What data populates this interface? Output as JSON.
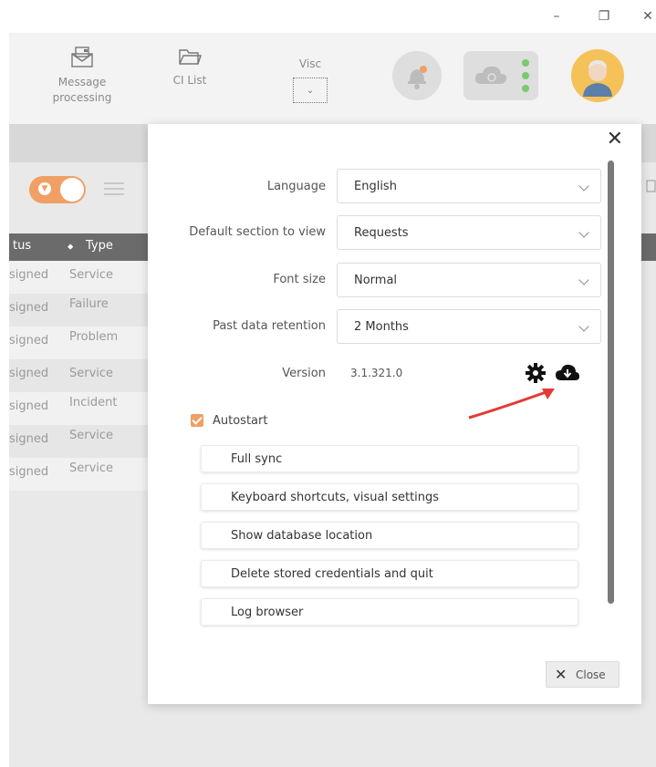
{
  "window": {
    "minimize_icon": "minimize-icon",
    "restore_icon": "restore-icon",
    "close_icon": "close-icon",
    "minimize_glyph": "–",
    "restore_glyph": "❐",
    "close_glyph": "✕"
  },
  "toolbar": {
    "message_processing_line1": "Message",
    "message_processing_line2": "processing",
    "ci_list": "CI List",
    "visc": "Visc",
    "visc_glyph": "⌄"
  },
  "list": {
    "header_status": "tus",
    "header_type": "Type",
    "header_sort_glyph": "⬥",
    "rows": [
      {
        "status": "signed",
        "type": "Service"
      },
      {
        "status": "signed",
        "type": "Failure"
      },
      {
        "status": "signed",
        "type": "Problem"
      },
      {
        "status": "signed",
        "type": "Service"
      },
      {
        "status": "signed",
        "type": "Incident"
      },
      {
        "status": "signed",
        "type": "Service"
      },
      {
        "status": "signed",
        "type": "Service"
      }
    ]
  },
  "settings": {
    "close_glyph": "✕",
    "language_label": "Language",
    "language_value": "English",
    "default_section_label": "Default section to view",
    "default_section_value": "Requests",
    "font_size_label": "Font size",
    "font_size_value": "Normal",
    "past_data_label": "Past data retention",
    "past_data_value": "2 Months",
    "version_label": "Version",
    "version_value": "3.1.321.0",
    "autostart_label": "Autostart",
    "autostart_checked": true,
    "buttons": [
      "Full sync",
      "Keyboard shortcuts, visual settings",
      "Show database location",
      "Delete stored credentials and quit",
      "Log browser"
    ],
    "close_button_label": "Close",
    "close_button_glyph": "✕"
  },
  "colors": {
    "accent": "#f0a065",
    "header_dark": "#6b6b6b",
    "annotation_arrow": "#e53935"
  }
}
